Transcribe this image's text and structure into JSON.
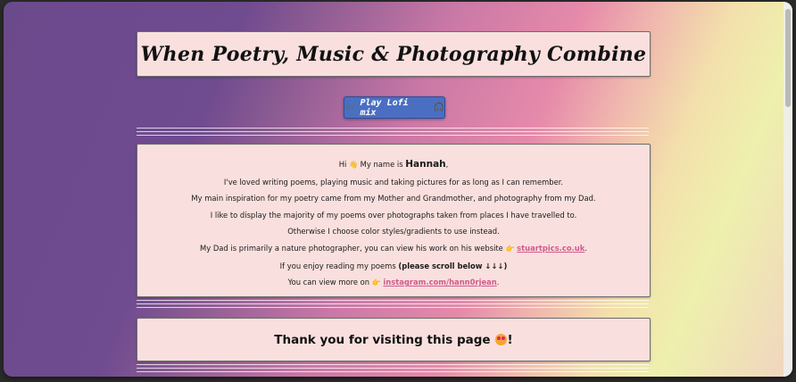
{
  "header": {
    "title": "When Poetry, Music & Photography Combine"
  },
  "play_button": {
    "icon": "🎶",
    "label": "Play Lofi mix",
    "icon_after": "🎧"
  },
  "intro": {
    "greeting_prefix": "Hi",
    "wave_emoji": "👋",
    "greeting_mid": "My name is",
    "name": "Hannah",
    "greeting_suffix": ",",
    "line2": "I've loved writing poems, playing music and taking pictures for as long as I can remember.",
    "line3": "My main inspiration for my poetry came from my Mother and Grandmother, and photography from my Dad.",
    "line4": "I like to display the majority of my poems over photographs taken from places I have travelled to.",
    "line5": "Otherwise I choose color styles/gradients to use instead.",
    "line6_prefix": "My Dad is primarily a nature photographer, you can view his work on his website",
    "point_emoji": "👉",
    "website_link": "stuartpics.co.uk",
    "line6_suffix": ".",
    "line7_prefix": "If you enjoy reading my poems",
    "line7_bold": "(please scroll below ↓↓↓)",
    "line8_prefix": "You can view more on",
    "instagram_link": "instagram.com/hann0rjean",
    "line8_suffix": "."
  },
  "footer": {
    "thanks_text": "Thank you for visiting this page",
    "thanks_suffix": "!"
  },
  "colors": {
    "card_bg": "#f9e0de",
    "button_bg": "#4a6fc2",
    "link": "#d05a8c"
  }
}
